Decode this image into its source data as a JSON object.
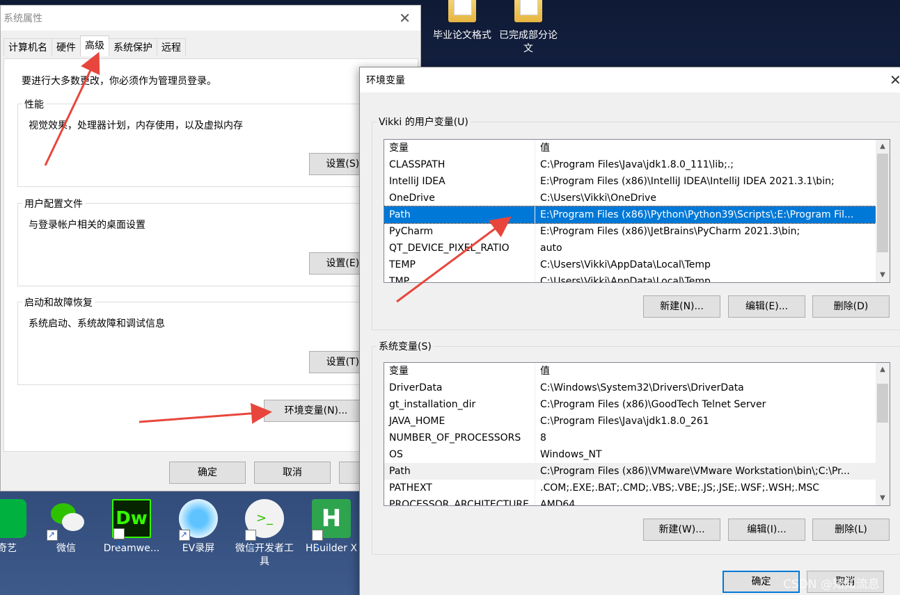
{
  "desktop": {
    "top_icons": [
      {
        "label": "毕业论文格式"
      },
      {
        "label": "已完成部分论文"
      }
    ],
    "bottom_icons": [
      {
        "label": "奇艺"
      },
      {
        "label": "微信"
      },
      {
        "label": "Dreamwe..."
      },
      {
        "label": "EV录屏"
      },
      {
        "label": "微信开发者工具"
      },
      {
        "label": "HBuilder X"
      }
    ]
  },
  "system_properties": {
    "title": "系统属性",
    "tabs": [
      "计算机名",
      "硬件",
      "高级",
      "系统保护",
      "远程"
    ],
    "active_tab": "高级",
    "admin_note": "要进行大多数更改，你必须作为管理员登录。",
    "performance": {
      "label": "性能",
      "desc": "视觉效果，处理器计划，内存使用，以及虚拟内存",
      "button": "设置(S)..."
    },
    "user_profiles": {
      "label": "用户配置文件",
      "desc": "与登录帐户相关的桌面设置",
      "button": "设置(E)..."
    },
    "startup": {
      "label": "启动和故障恢复",
      "desc": "系统启动、系统故障和调试信息",
      "button": "设置(T)..."
    },
    "env_button": "环境变量(N)...",
    "ok": "确定",
    "cancel": "取消"
  },
  "env_vars": {
    "title": "环境变量",
    "user_group_label": "Vikki 的用户变量(U)",
    "col_name": "变量",
    "col_value": "值",
    "user_vars": [
      {
        "name": "CLASSPATH",
        "value": "C:\\Program Files\\Java\\jdk1.8.0_111\\lib;.;"
      },
      {
        "name": "IntelliJ IDEA",
        "value": "E:\\Program Files (x86)\\IntelliJ IDEA\\IntelliJ IDEA 2021.3.1\\bin;"
      },
      {
        "name": "OneDrive",
        "value": "C:\\Users\\Vikki\\OneDrive"
      },
      {
        "name": "Path",
        "value": "E:\\Program Files (x86)\\Python\\Python39\\Scripts\\;E:\\Program Fil..."
      },
      {
        "name": "PyCharm",
        "value": "E:\\Program Files (x86)\\JetBrains\\PyCharm 2021.3\\bin;"
      },
      {
        "name": "QT_DEVICE_PIXEL_RATIO",
        "value": "auto"
      },
      {
        "name": "TEMP",
        "value": "C:\\Users\\Vikki\\AppData\\Local\\Temp"
      },
      {
        "name": "TMP",
        "value": "C:\\Users\\Vikki\\AppData\\Local\\Temp"
      }
    ],
    "user_buttons": {
      "new": "新建(N)...",
      "edit": "编辑(E)...",
      "delete": "删除(D)"
    },
    "system_group_label": "系统变量(S)",
    "system_vars": [
      {
        "name": "DriverData",
        "value": "C:\\Windows\\System32\\Drivers\\DriverData"
      },
      {
        "name": "gt_installation_dir",
        "value": "C:\\Program Files (x86)\\GoodTech Telnet Server"
      },
      {
        "name": "JAVA_HOME",
        "value": "C:\\Program Files\\Java\\jdk1.8.0_261"
      },
      {
        "name": "NUMBER_OF_PROCESSORS",
        "value": "8"
      },
      {
        "name": "OS",
        "value": "Windows_NT"
      },
      {
        "name": "Path",
        "value": "C:\\Program Files (x86)\\VMware\\VMware Workstation\\bin\\;C:\\Pr..."
      },
      {
        "name": "PATHEXT",
        "value": ".COM;.EXE;.BAT;.CMD;.VBS;.VBE;.JS;.JSE;.WSF;.WSH;.MSC"
      },
      {
        "name": "PROCESSOR_ARCHITECTURE",
        "value": "AMD64"
      }
    ],
    "system_buttons": {
      "new": "新建(W)...",
      "edit": "编辑(I)...",
      "delete": "删除(L)"
    },
    "ok": "确定",
    "cancel": "取消"
  },
  "watermark": "CSDN @知知流息",
  "accent_color": "#0078d7",
  "annotation_arrow_color": "#e8463c"
}
